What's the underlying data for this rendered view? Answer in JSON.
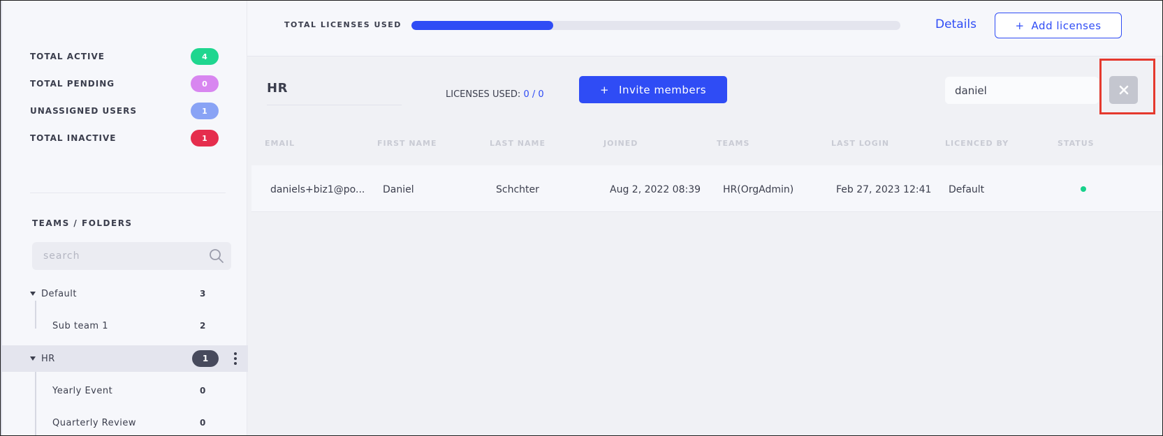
{
  "stats": [
    {
      "label": "TOTAL ACTIVE",
      "count": "4",
      "color": "#1fd68f"
    },
    {
      "label": "TOTAL PENDING",
      "count": "0",
      "color": "#d886f0"
    },
    {
      "label": "UNASSIGNED USERS",
      "count": "1",
      "color": "#89a3f5"
    },
    {
      "label": "TOTAL INACTIVE",
      "count": "1",
      "color": "#e52d4d"
    }
  ],
  "sidebar": {
    "section_title": "TEAMS / FOLDERS",
    "search_placeholder": "search",
    "tree": [
      {
        "label": "Default",
        "count": "3",
        "expanded": true
      },
      {
        "label": "Sub team 1",
        "count": "2"
      },
      {
        "label": "HR",
        "count": "1",
        "expanded": true,
        "selected": true
      },
      {
        "label": "Yearly Event",
        "count": "0"
      },
      {
        "label": "Quarterly Review",
        "count": "0"
      }
    ]
  },
  "topbar": {
    "licenses_title": "TOTAL LICENSES USED",
    "licenses_progress": 0.29,
    "details_label": "Details",
    "add_licenses_label": "Add licenses"
  },
  "main": {
    "team_name": "HR",
    "licenses_used_label": "LICENSES USED:",
    "licenses_used_value": "0 / 0",
    "invite_label": "Invite members",
    "search_value": "daniel"
  },
  "table": {
    "columns": [
      "EMAIL",
      "FIRST NAME",
      "LAST NAME",
      "JOINED",
      "TEAMS",
      "LAST LOGIN",
      "LICENCED BY",
      "STATUS"
    ],
    "rows": [
      {
        "email": "daniels+biz1@po...",
        "first_name": "Daniel",
        "last_name": "Schchter",
        "joined": "Aug 2, 2022 08:39",
        "teams": "HR(OrgAdmin)",
        "last_login": "Feb 27, 2023 12:41",
        "licenced_by": "Default",
        "status": "active"
      }
    ]
  },
  "colors": {
    "accent": "#2f4cf5",
    "status_active": "#17d18b",
    "highlight": "#e5392e"
  }
}
